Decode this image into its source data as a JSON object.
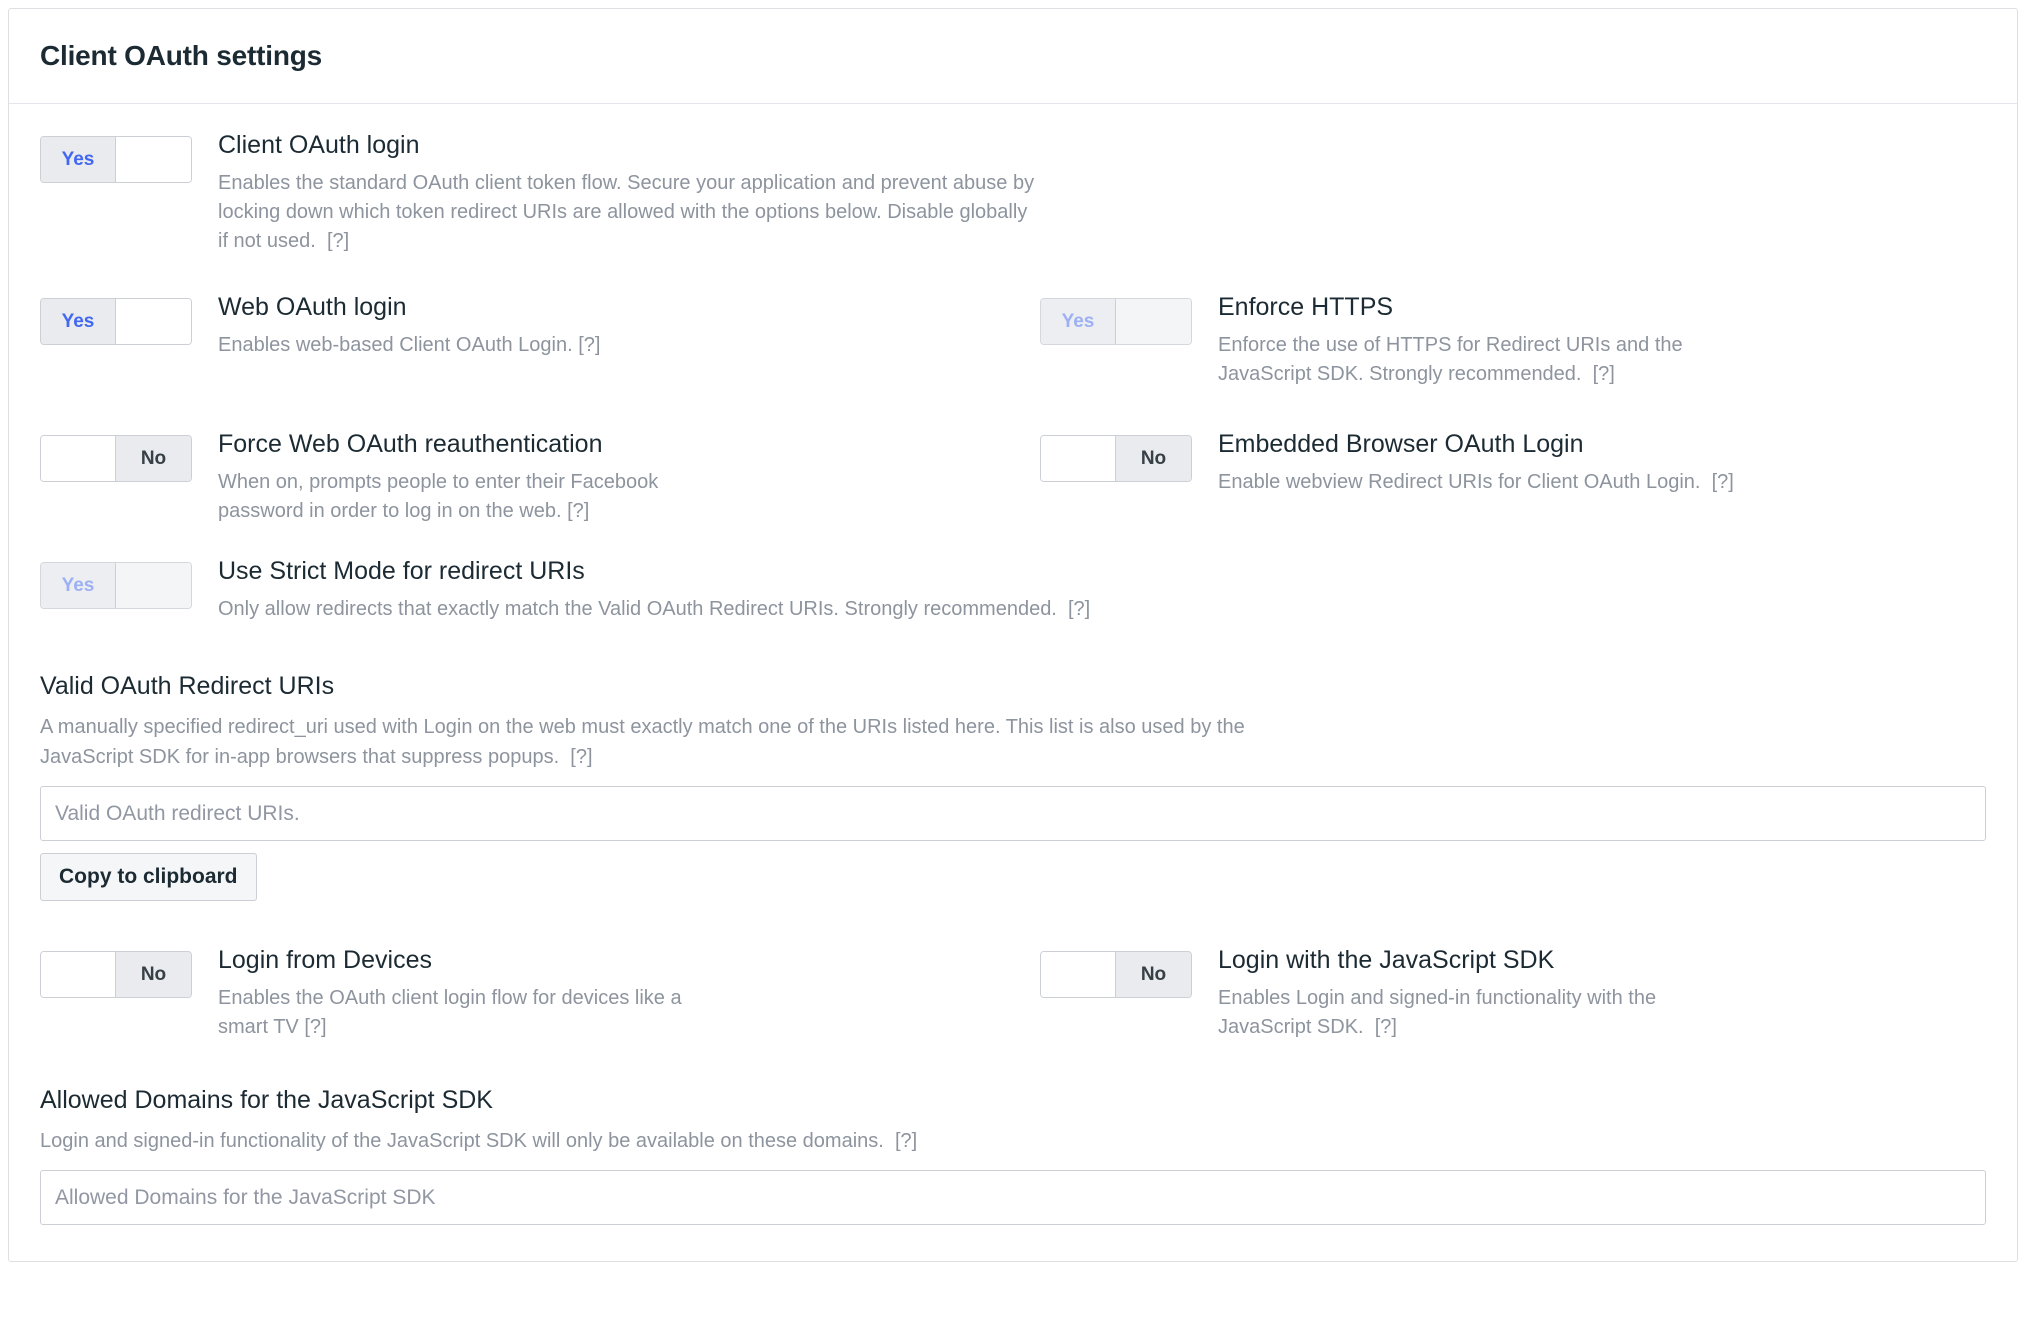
{
  "card": {
    "title": "Client OAuth settings"
  },
  "options": [
    {
      "id": "client-oauth-login",
      "toggle": {
        "state": "yes",
        "label": "Yes",
        "disabled": false
      },
      "title": "Client OAuth login",
      "description": "Enables the standard OAuth client token flow. Secure your application and prevent abuse by locking down which token redirect URIs are allowed with the options below. Disable globally if not used.",
      "help": "[?]"
    },
    {
      "id": "web-oauth-login",
      "toggle": {
        "state": "yes",
        "label": "Yes",
        "disabled": false
      },
      "title": "Web OAuth login",
      "description": "Enables web-based Client OAuth Login.",
      "help": "[?]"
    },
    {
      "id": "enforce-https",
      "toggle": {
        "state": "yes",
        "label": "Yes",
        "disabled": true
      },
      "title": "Enforce HTTPS",
      "description": "Enforce the use of HTTPS for Redirect URIs and the JavaScript SDK. Strongly recommended.",
      "help": "[?]"
    },
    {
      "id": "force-web-oauth-reauthentication",
      "toggle": {
        "state": "no",
        "label": "No",
        "disabled": false
      },
      "title": "Force Web OAuth reauthentication",
      "description": "When on, prompts people to enter their Facebook password in order to log in on the web.",
      "help": "[?]"
    },
    {
      "id": "embedded-browser-oauth-login",
      "toggle": {
        "state": "no",
        "label": "No",
        "disabled": false
      },
      "title": "Embedded Browser OAuth Login",
      "description": "Enable webview Redirect URIs for Client OAuth Login.",
      "help": "[?]"
    },
    {
      "id": "use-strict-mode-for-redirect-uris",
      "toggle": {
        "state": "yes",
        "label": "Yes",
        "disabled": true
      },
      "title": "Use Strict Mode for redirect URIs",
      "description": "Only allow redirects that exactly match the Valid OAuth Redirect URIs. Strongly recommended.",
      "help": "[?]"
    },
    {
      "id": "login-from-devices",
      "toggle": {
        "state": "no",
        "label": "No",
        "disabled": false
      },
      "title": "Login from Devices",
      "description": "Enables the OAuth client login flow for devices like a smart TV",
      "help": "[?]"
    },
    {
      "id": "login-with-the-javascript-sdk",
      "toggle": {
        "state": "no",
        "label": "No",
        "disabled": false
      },
      "title": "Login with the JavaScript SDK",
      "description": "Enables Login and signed-in functionality with the JavaScript SDK.",
      "help": "[?]"
    }
  ],
  "redirect_uris_section": {
    "title": "Valid OAuth Redirect URIs",
    "description": "A manually specified redirect_uri used with Login on the web must exactly match one of the URIs listed here. This list is also used by the JavaScript SDK for in-app browsers that suppress popups.",
    "help": "[?]",
    "input_placeholder": "Valid OAuth redirect URIs.",
    "input_value": "",
    "copy_button_label": "Copy to clipboard"
  },
  "allowed_domains_section": {
    "title": "Allowed Domains for the JavaScript SDK",
    "description": "Login and signed-in functionality of the JavaScript SDK will only be available on these domains.",
    "help": "[?]",
    "input_placeholder": "Allowed Domains for the JavaScript SDK",
    "input_value": ""
  },
  "colors": {
    "accent_blue": "#4267f0",
    "accent_blue_disabled": "#9db0f3",
    "text_primary": "#1c2b33",
    "text_secondary": "#8d949e",
    "border": "#ccd0d5",
    "toggle_fill": "#e9ebee"
  }
}
